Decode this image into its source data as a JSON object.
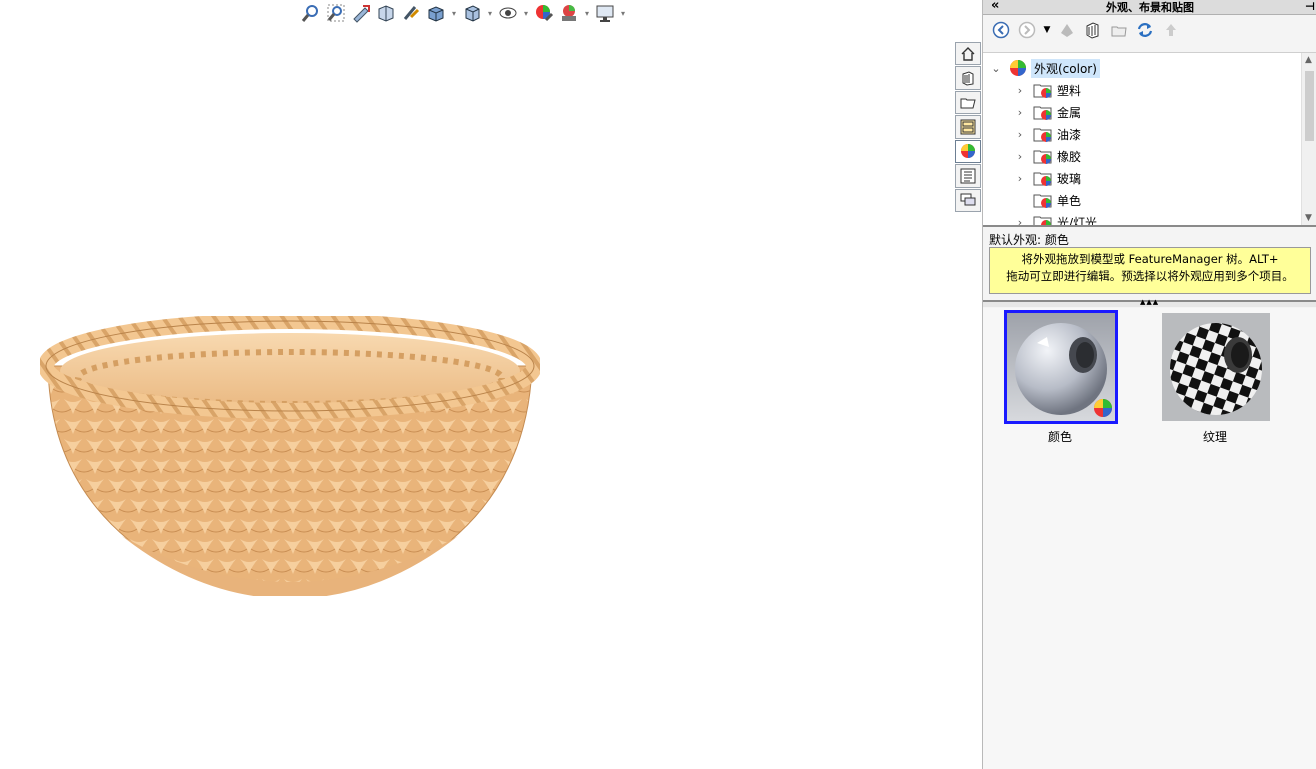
{
  "hud_toolbar": {
    "icons": [
      "zoom-to-fit-icon",
      "zoom-to-area-icon",
      "previous-view-icon",
      "section-view-icon",
      "dynamic-annotation-icon",
      "view-orientation-icon",
      "display-style-icon",
      "hide-show-items-icon",
      "edit-appearance-icon",
      "apply-scene-icon",
      "view-settings-icon"
    ]
  },
  "task_pane": {
    "title": "外观、布景和贴图",
    "tree": {
      "root": "外观(color)",
      "items": [
        {
          "label": "塑料",
          "expandable": true
        },
        {
          "label": "金属",
          "expandable": true
        },
        {
          "label": "油漆",
          "expandable": true
        },
        {
          "label": "橡胶",
          "expandable": true
        },
        {
          "label": "玻璃",
          "expandable": true
        },
        {
          "label": "单色",
          "expandable": false
        },
        {
          "label": "光/灯光",
          "expandable": true
        }
      ]
    },
    "default_appearance": "默认外观: 颜色",
    "tip_line1": "将外观拖放到模型或 FeatureManager 树。ALT+",
    "tip_line2": "拖动可立即进行编辑。预选择以将外观应用到多个项目。",
    "swatches": [
      {
        "label": "颜色",
        "selected": true
      },
      {
        "label": "纹理",
        "selected": false
      }
    ]
  },
  "model": {
    "name": "woven-basket",
    "color": "#f2c48e"
  },
  "colors": {
    "selection": "#1a1aff",
    "tip_bg": "#ffff99",
    "tree_highlight": "#cfe6fb"
  }
}
